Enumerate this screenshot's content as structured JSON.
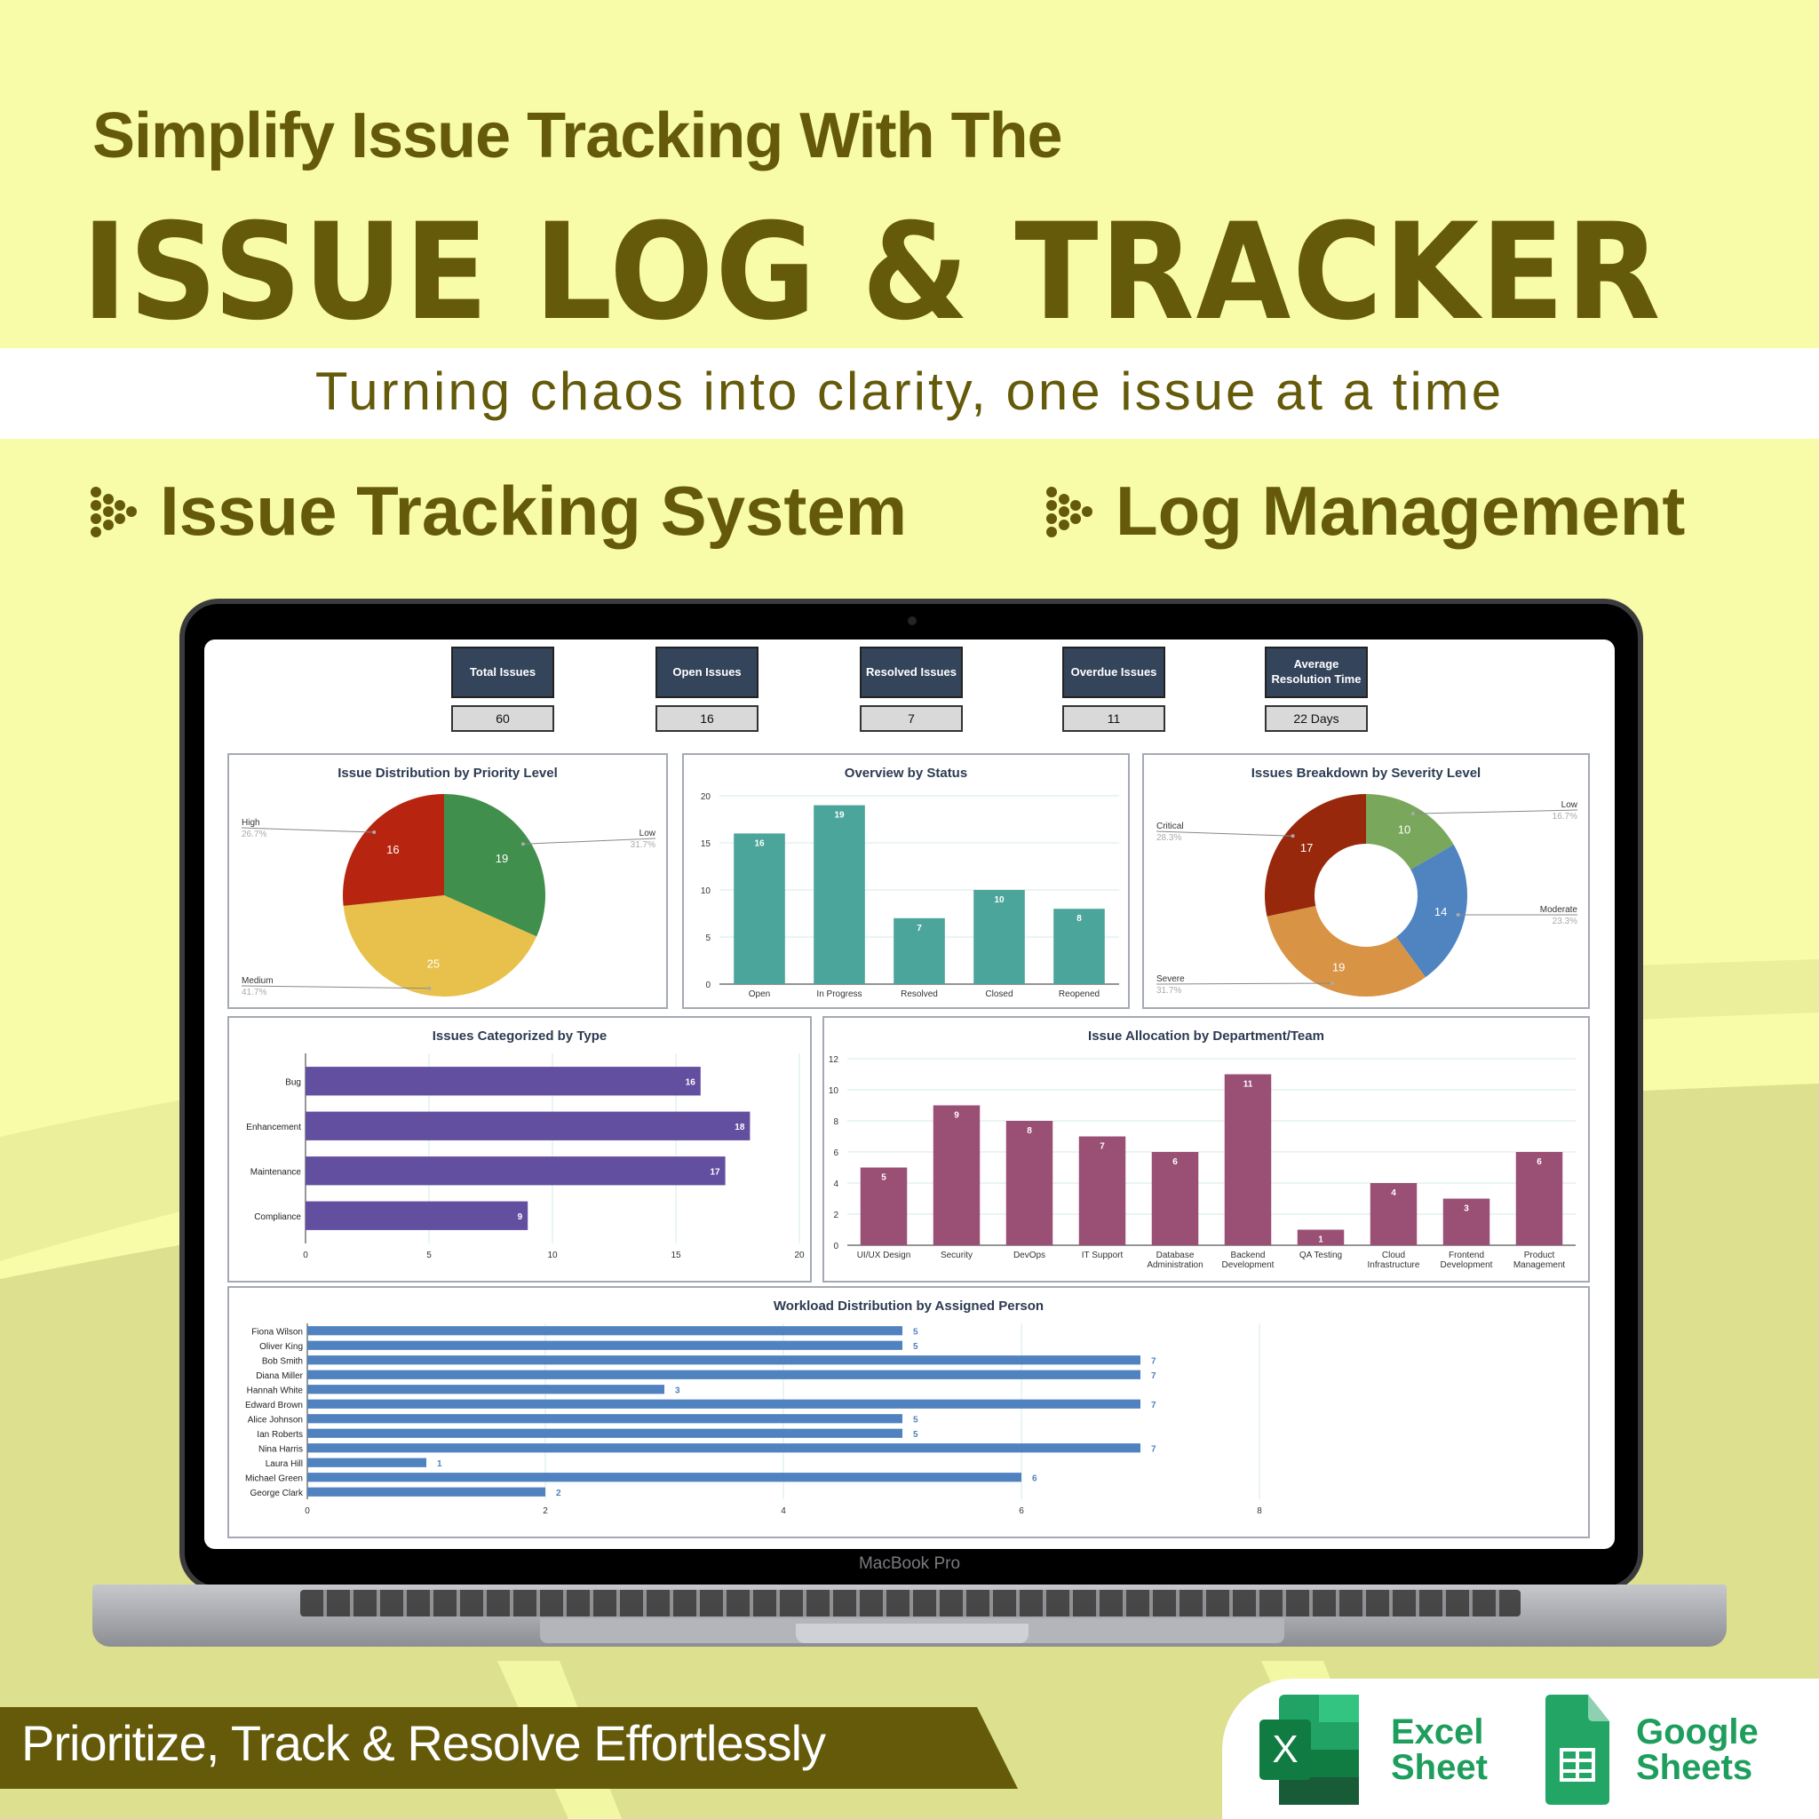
{
  "hero": {
    "subtitle": "Simplify Issue Tracking With The",
    "title": "ISSUE LOG & TRACKER",
    "tagline": "Turning chaos into clarity, one issue at a time",
    "features": [
      "Issue Tracking System",
      "Log Management"
    ]
  },
  "colors": {
    "background": "#f8fca8",
    "brand_olive": "#645a0a",
    "kpi_header": "#34445a",
    "kpi_value_bg": "#d9d9d9"
  },
  "laptop": {
    "brand_label": "MacBook Pro"
  },
  "kpis": [
    {
      "label": "Total Issues",
      "value": "60"
    },
    {
      "label": "Open Issues",
      "value": "16"
    },
    {
      "label": "Resolved Issues",
      "value": "7"
    },
    {
      "label": "Overdue Issues",
      "value": "11"
    },
    {
      "label": "Average Resolution Time",
      "value": "22  Days"
    }
  ],
  "chart_data": [
    {
      "id": "priority",
      "type": "pie",
      "title": "Issue Distribution by Priority Level",
      "slices": [
        {
          "label": "Low",
          "value": 19,
          "percent": "31.7%",
          "color": "#418f4c"
        },
        {
          "label": "Medium",
          "value": 25,
          "percent": "41.7%",
          "color": "#e8c14d"
        },
        {
          "label": "High",
          "value": 16,
          "percent": "26.7%",
          "color": "#b7240f"
        }
      ]
    },
    {
      "id": "status",
      "type": "bar",
      "title": "Overview by Status",
      "categories": [
        "Open",
        "In Progress",
        "Resolved",
        "Closed",
        "Reopened"
      ],
      "values": [
        16,
        19,
        7,
        10,
        8
      ],
      "ylim": [
        0,
        20
      ],
      "yticks": [
        0,
        5,
        10,
        15,
        20
      ],
      "color": "#4ba59a",
      "grid": true
    },
    {
      "id": "severity",
      "type": "pie",
      "donut": true,
      "title": "Issues Breakdown by Severity Level",
      "slices": [
        {
          "label": "Low",
          "value": 10,
          "percent": "16.7%",
          "color": "#79a75b"
        },
        {
          "label": "Moderate",
          "value": 14,
          "percent": "23.3%",
          "color": "#4f84c1"
        },
        {
          "label": "Severe",
          "value": 19,
          "percent": "31.7%",
          "color": "#d99345"
        },
        {
          "label": "Critical",
          "value": 17,
          "percent": "28.3%",
          "color": "#98280c"
        }
      ]
    },
    {
      "id": "type",
      "type": "bar",
      "orientation": "horizontal",
      "title": "Issues Categorized by Type",
      "categories": [
        "Bug",
        "Enhancement",
        "Maintenance",
        "Compliance"
      ],
      "values": [
        16,
        18,
        17,
        9
      ],
      "xlim": [
        0,
        20
      ],
      "xticks": [
        0,
        5,
        10,
        15,
        20
      ],
      "color": "#634fa0",
      "grid": true
    },
    {
      "id": "department",
      "type": "bar",
      "title": "Issue Allocation by Department/Team",
      "categories": [
        "UI/UX Design",
        "Security",
        "DevOps",
        "IT Support",
        "Database Administration",
        "Backend Development",
        "QA Testing",
        "Cloud Infrastructure",
        "Frontend Development",
        "Product Management"
      ],
      "values": [
        5,
        9,
        8,
        7,
        6,
        11,
        1,
        4,
        3,
        6
      ],
      "ylim": [
        0,
        12
      ],
      "yticks": [
        0,
        2,
        4,
        6,
        8,
        10,
        12
      ],
      "color": "#9a4f74",
      "grid": true
    },
    {
      "id": "workload",
      "type": "bar",
      "orientation": "horizontal",
      "title": "Workload Distribution by Assigned Person",
      "categories": [
        "Fiona Wilson",
        "Oliver King",
        "Bob Smith",
        "Diana Miller",
        "Hannah White",
        "Edward Brown",
        "Alice Johnson",
        "Ian Roberts",
        "Nina Harris",
        "Laura Hill",
        "Michael Green",
        "George Clark"
      ],
      "values": [
        5,
        5,
        7,
        7,
        3,
        7,
        5,
        5,
        7,
        1,
        6,
        2
      ],
      "xlim": [
        0,
        8
      ],
      "xticks": [
        0,
        2,
        4,
        6,
        8
      ],
      "color": "#4f82bf",
      "label_color": "#4f82bf",
      "grid": true
    }
  ],
  "footer": {
    "banner": "Prioritize, Track & Resolve Effortlessly",
    "excel_label_1": "Excel",
    "excel_label_2": "Sheet",
    "sheets_label_1": "Google",
    "sheets_label_2": "Sheets"
  }
}
